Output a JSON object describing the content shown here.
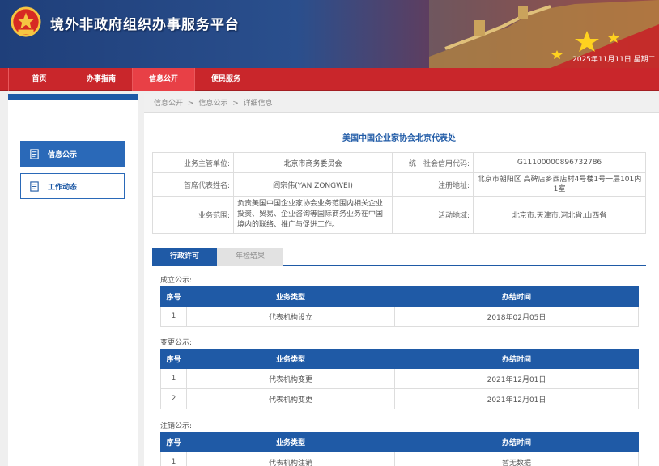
{
  "header": {
    "site_title": "境外非政府组织办事服务平台",
    "datetime": "2025年11月11日 星期二"
  },
  "nav": {
    "items": [
      {
        "label": "首页"
      },
      {
        "label": "办事指南"
      },
      {
        "label": "信息公开"
      },
      {
        "label": "便民服务"
      }
    ]
  },
  "sidebar": {
    "items": [
      {
        "label": "信息公示"
      },
      {
        "label": "工作动态"
      }
    ]
  },
  "breadcrumb": {
    "items": [
      "信息公开",
      ">",
      "信息公示",
      ">",
      "详细信息"
    ]
  },
  "org": {
    "title": "美国中国企业家协会北京代表处",
    "info": {
      "supervisor_label": "业务主管单位:",
      "supervisor": "北京市商务委员会",
      "credit_code_label": "统一社会信用代码:",
      "credit_code": "G11100000896732786",
      "chief_label": "首席代表姓名:",
      "chief": "阎宗伟(YAN ZONGWEI)",
      "address_label": "注册地址:",
      "address": "北京市朝阳区 高碑店乡西店村4号楼1号一层101内1室",
      "scope_label": "业务范围:",
      "scope": "负责美国中国企业家协会业务范围内相关企业投资、贸易、企业咨询等国际商务业务在中国境内的联络、推广与促进工作。",
      "region_label": "活动地域:",
      "region": "北京市,天津市,河北省,山西省"
    }
  },
  "tabs": {
    "admin_license": "行政许可",
    "annual_check": "年检结果"
  },
  "table_headers": {
    "seq": "序号",
    "type": "业务类型",
    "time": "办结时间"
  },
  "sections": {
    "establish": {
      "label": "成立公示:",
      "rows": [
        {
          "seq": "1",
          "type": "代表机构设立",
          "time": "2018年02月05日"
        }
      ]
    },
    "change": {
      "label": "变更公示:",
      "rows": [
        {
          "seq": "1",
          "type": "代表机构变更",
          "time": "2021年12月01日"
        },
        {
          "seq": "2",
          "type": "代表机构变更",
          "time": "2021年12月01日"
        }
      ]
    },
    "cancel": {
      "label": "注销公示:",
      "rows": [
        {
          "seq": "1",
          "type": "代表机构注销",
          "time": "暂无数据"
        }
      ]
    }
  },
  "colors": {
    "brand_blue": "#1f5aa6",
    "nav_red": "#c9262b",
    "no_data_red": "#d6262b"
  }
}
